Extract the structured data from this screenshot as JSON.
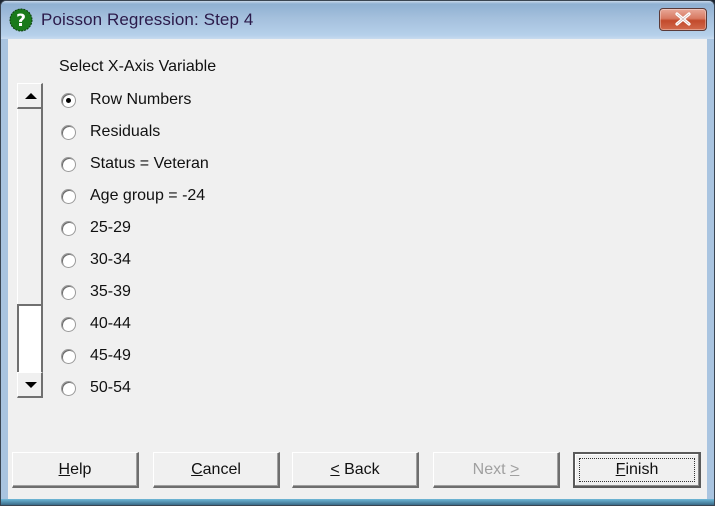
{
  "window": {
    "title": "Poisson Regression: Step 4",
    "icon": "help-question-icon",
    "close_icon": "close-icon"
  },
  "section_label": "Select X-Axis Variable",
  "radio_options": [
    {
      "label": "Row Numbers",
      "checked": true
    },
    {
      "label": "Residuals",
      "checked": false
    },
    {
      "label": "Status = Veteran",
      "checked": false
    },
    {
      "label": "Age group = -24",
      "checked": false
    },
    {
      "label": "25-29",
      "checked": false
    },
    {
      "label": "30-34",
      "checked": false
    },
    {
      "label": "35-39",
      "checked": false
    },
    {
      "label": "40-44",
      "checked": false
    },
    {
      "label": "45-49",
      "checked": false
    },
    {
      "label": "50-54",
      "checked": false
    }
  ],
  "scrollbar": {
    "position": "bottom",
    "up_icon": "arrow-up-icon",
    "down_icon": "arrow-down-icon"
  },
  "buttons": {
    "help": {
      "mnemonic": "H",
      "rest": "elp",
      "enabled": true
    },
    "cancel": {
      "mnemonic": "C",
      "rest": "ancel",
      "enabled": true
    },
    "back": {
      "mnemonic": "<",
      "rest": " Back",
      "enabled": true
    },
    "next": {
      "pre": "Next ",
      "mnemonic": ">",
      "enabled": false
    },
    "finish": {
      "mnemonic": "F",
      "rest": "inish",
      "enabled": true,
      "default": true
    }
  },
  "colors": {
    "titlebar": "#a3bfdc",
    "client_bg": "#f0f0f0",
    "close_button": "#c24a2c",
    "icon_green": "#1a7a1a",
    "disabled_text": "#a0a0a0"
  }
}
